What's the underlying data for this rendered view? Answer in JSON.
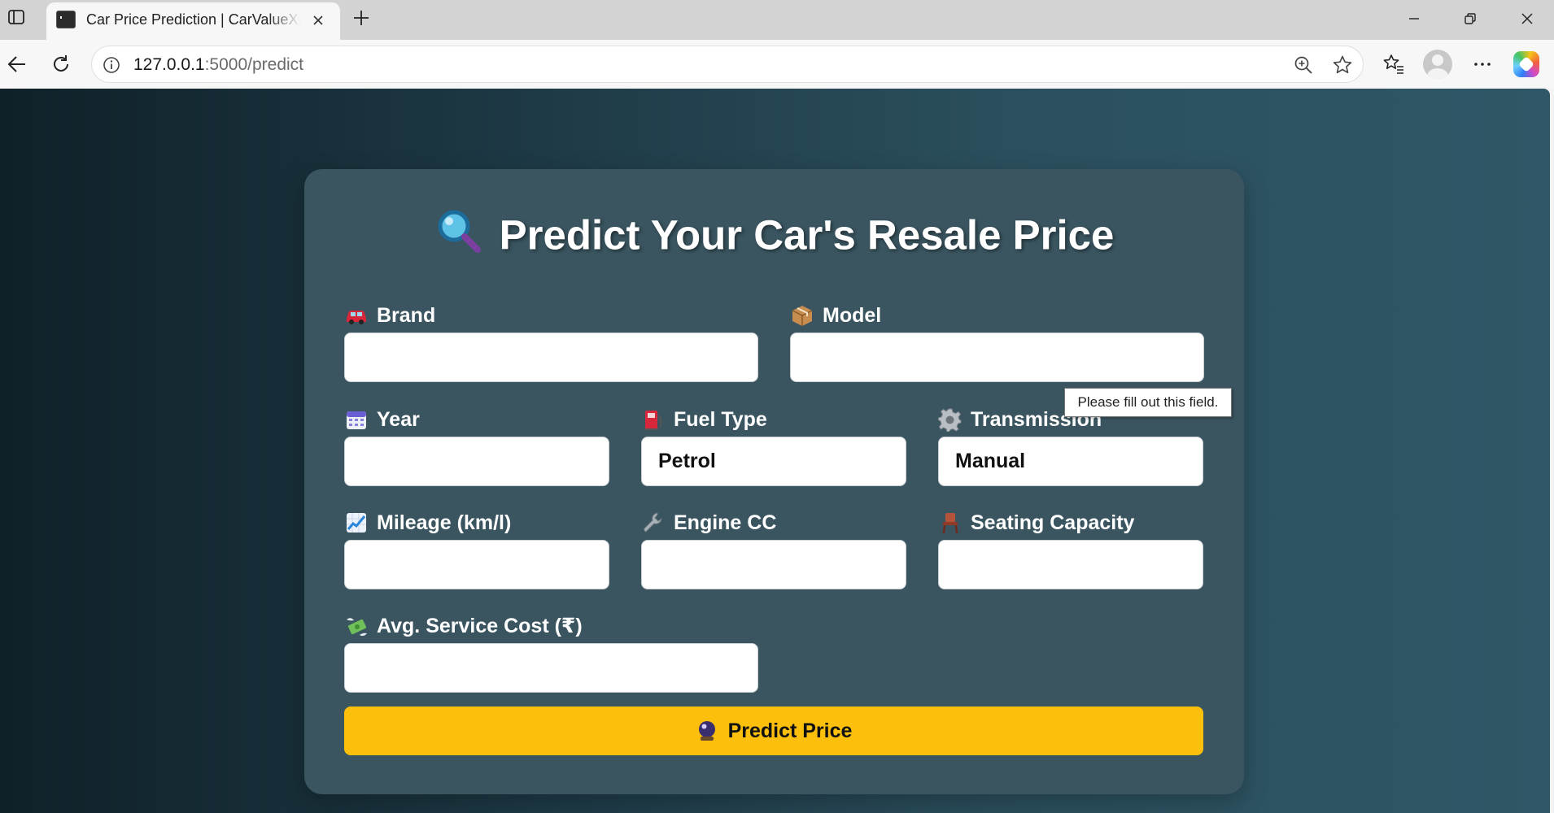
{
  "browser": {
    "tab_title": "Car Price Prediction | CarValueXpert",
    "url_host": "127.0.0.1",
    "url_path": ":5000/predict"
  },
  "page": {
    "title": "Predict Your Car's Resale Price",
    "tooltip": "Please fill out this field.",
    "submit_label": "Predict Price",
    "fields": {
      "brand": {
        "label": "Brand",
        "value": ""
      },
      "model": {
        "label": "Model",
        "value": ""
      },
      "year": {
        "label": "Year",
        "value": ""
      },
      "fuel": {
        "label": "Fuel Type",
        "value": "Petrol"
      },
      "transmission": {
        "label": "Transmission",
        "value": "Manual"
      },
      "mileage": {
        "label": "Mileage (km/l)",
        "value": ""
      },
      "engine": {
        "label": "Engine CC",
        "value": ""
      },
      "seating": {
        "label": "Seating Capacity",
        "value": ""
      },
      "service": {
        "label": "Avg. Service Cost (₹)",
        "value": ""
      }
    }
  },
  "colors": {
    "card": "#3a5560",
    "button": "#fbbf0c"
  }
}
